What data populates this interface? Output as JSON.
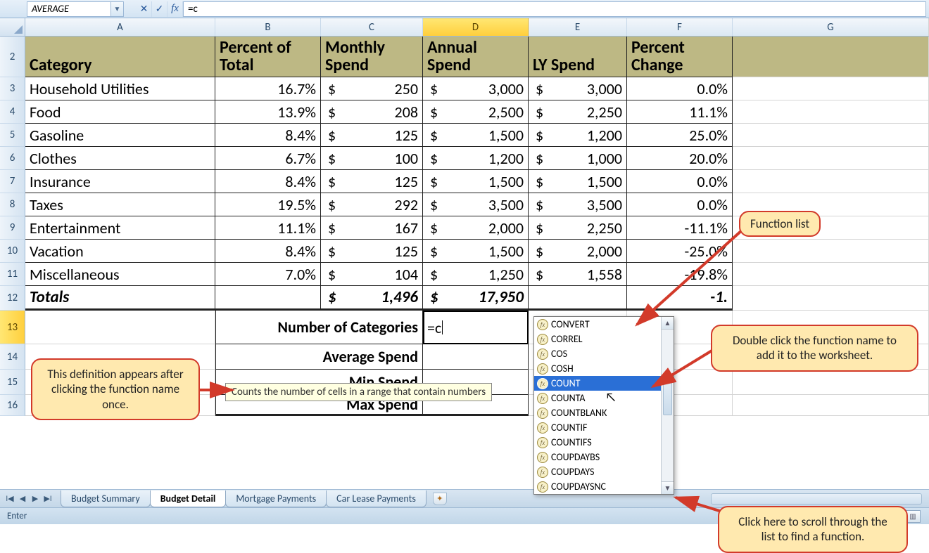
{
  "formula_bar": {
    "name_box": "AVERAGE",
    "formula": "=c"
  },
  "columns": [
    "A",
    "B",
    "C",
    "D",
    "E",
    "F",
    "G"
  ],
  "active_col": "D",
  "active_row": 13,
  "headers": {
    "A": "Category",
    "B": "Percent of Total",
    "C": "Monthly Spend",
    "D": "Annual Spend",
    "E": "LY Spend",
    "F": "Percent Change"
  },
  "rows": [
    {
      "n": 3,
      "cat": "Household Utilities",
      "pct": "16.7%",
      "mon": "250",
      "ann": "3,000",
      "ly": "3,000",
      "chg": "0.0%"
    },
    {
      "n": 4,
      "cat": "Food",
      "pct": "13.9%",
      "mon": "208",
      "ann": "2,500",
      "ly": "2,250",
      "chg": "11.1%"
    },
    {
      "n": 5,
      "cat": "Gasoline",
      "pct": "8.4%",
      "mon": "125",
      "ann": "1,500",
      "ly": "1,200",
      "chg": "25.0%"
    },
    {
      "n": 6,
      "cat": "Clothes",
      "pct": "6.7%",
      "mon": "100",
      "ann": "1,200",
      "ly": "1,000",
      "chg": "20.0%"
    },
    {
      "n": 7,
      "cat": "Insurance",
      "pct": "8.4%",
      "mon": "125",
      "ann": "1,500",
      "ly": "1,500",
      "chg": "0.0%"
    },
    {
      "n": 8,
      "cat": "Taxes",
      "pct": "19.5%",
      "mon": "292",
      "ann": "3,500",
      "ly": "3,500",
      "chg": "0.0%"
    },
    {
      "n": 9,
      "cat": "Entertainment",
      "pct": "11.1%",
      "mon": "167",
      "ann": "2,000",
      "ly": "2,250",
      "chg": "-11.1%"
    },
    {
      "n": 10,
      "cat": "Vacation",
      "pct": "8.4%",
      "mon": "125",
      "ann": "1,500",
      "ly": "2,000",
      "chg": "-25.0%"
    },
    {
      "n": 11,
      "cat": "Miscellaneous",
      "pct": "7.0%",
      "mon": "104",
      "ann": "1,250",
      "ly": "1,558",
      "chg": "-19.8%"
    }
  ],
  "totals": {
    "label": "Totals",
    "mon": "1,496",
    "ann": "17,950",
    "chg": "-1."
  },
  "summary_labels": {
    "num_categories": "Number of Categories",
    "avg_spend": "Average Spend",
    "min_spend": "Min Spend",
    "max_spend": "Max Spend"
  },
  "editing_value": "=c",
  "function_list": [
    "CONVERT",
    "CORREL",
    "COS",
    "COSH",
    "COUNT",
    "COUNTA",
    "COUNTBLANK",
    "COUNTIF",
    "COUNTIFS",
    "COUPDAYBS",
    "COUPDAYS",
    "COUPDAYSNC"
  ],
  "function_selected_index": 4,
  "tooltip": "Counts the number of cells in a range that contain numbers",
  "callouts": {
    "left": "This definition appears after clicking the function name once.",
    "top_right": "Function list",
    "mid_right": "Double click the function name to add it to the worksheet.",
    "bottom_right": "Click here to scroll through the list to find a function."
  },
  "tabs": [
    "Budget Summary",
    "Budget Detail",
    "Mortgage Payments",
    "Car Lease Payments"
  ],
  "active_tab": 1,
  "status": "Enter",
  "row_nums_extra": [
    14,
    15,
    16
  ]
}
